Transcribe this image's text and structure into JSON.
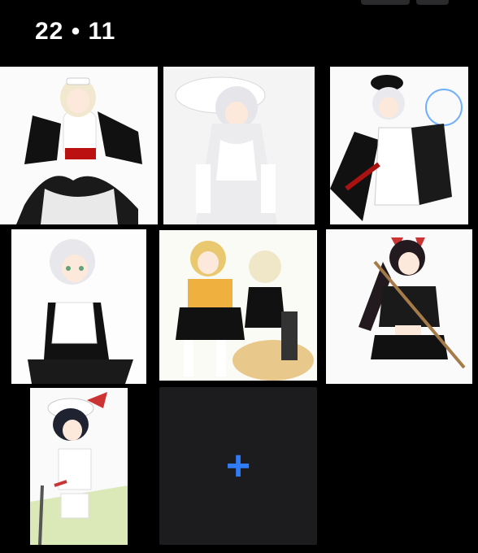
{
  "header": {
    "title": "22 • 11"
  },
  "gallery": {
    "items": [
      {
        "name": "maid-blonde-glasses",
        "desc_icon": "image-thumbnail"
      },
      {
        "name": "white-hat-dress",
        "desc_icon": "image-thumbnail"
      },
      {
        "name": "officer-cape",
        "desc_icon": "image-thumbnail"
      },
      {
        "name": "silver-maid-green-eyes",
        "desc_icon": "image-thumbnail"
      },
      {
        "name": "duo-sweater-maid",
        "desc_icon": "image-thumbnail"
      },
      {
        "name": "cat-ear-sword",
        "desc_icon": "image-thumbnail"
      },
      {
        "name": "baseball-cap-bat",
        "desc_icon": "image-thumbnail"
      }
    ],
    "add_label": "+"
  },
  "colors": {
    "background": "#000000",
    "tile": "#1c1c1e",
    "accent": "#2f7cf6"
  }
}
